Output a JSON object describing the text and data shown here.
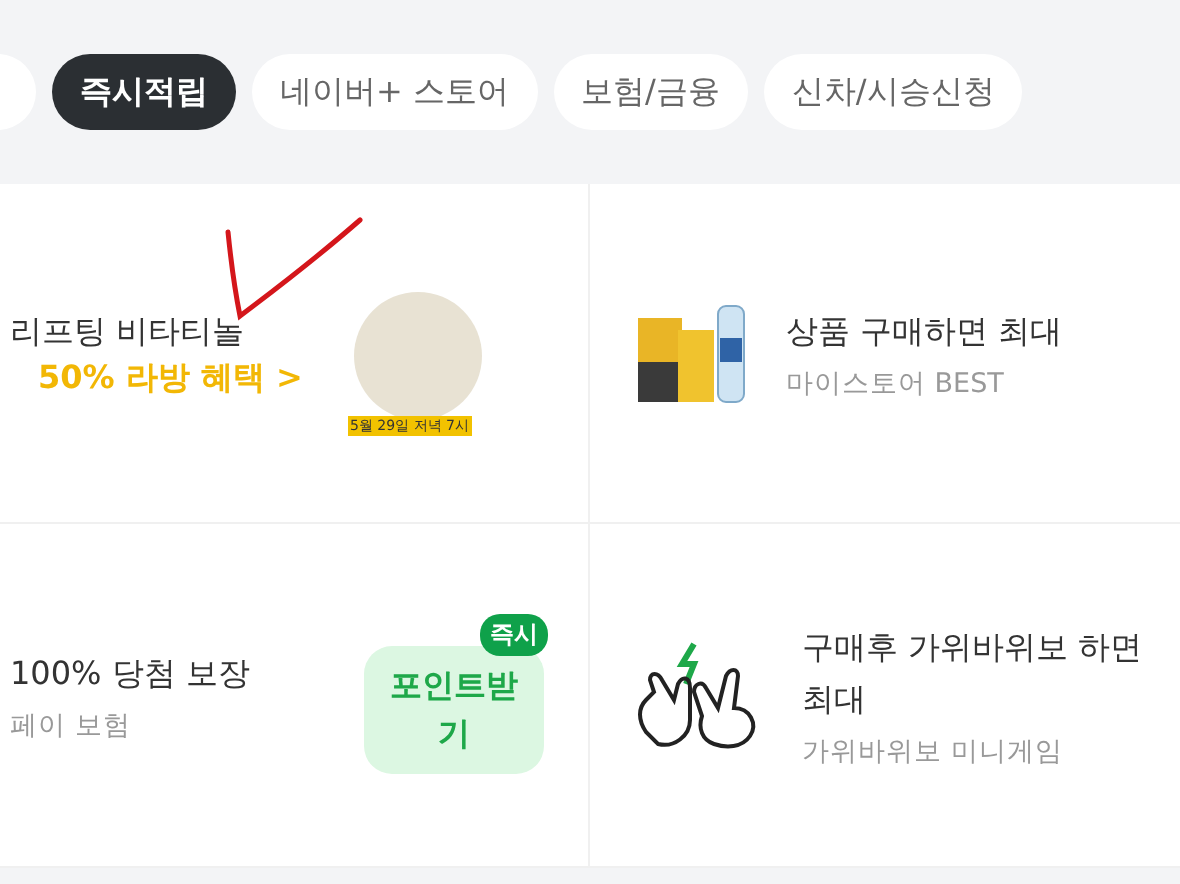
{
  "tabs": [
    {
      "label": "즉시적립",
      "selected": true
    },
    {
      "label": "네이버+ 스토어",
      "selected": false
    },
    {
      "label": "보험/금융",
      "selected": false
    },
    {
      "label": "신차/시승신청",
      "selected": false
    }
  ],
  "cards": [
    {
      "kind": "promo",
      "title": "리프팅 비타티놀",
      "highlight": "50% 라방 혜택 >",
      "image_caption": "5월 29일 저녁 7시"
    },
    {
      "kind": "product",
      "title": "상품 구매하면 최대",
      "subtitle": "마이스토어 BEST"
    },
    {
      "kind": "button",
      "title": "100% 당첨 보장",
      "subtitle": "페이 보험",
      "button": "포인트받기",
      "badge": "즉시"
    },
    {
      "kind": "game",
      "title": "구매후 가위바위보 하면 최대",
      "subtitle": "가위바위보 미니게임"
    }
  ]
}
